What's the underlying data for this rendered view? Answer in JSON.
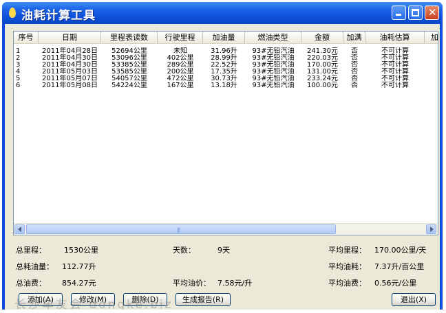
{
  "window": {
    "title": "油耗计算工具"
  },
  "table": {
    "columns": [
      "序号",
      "日期",
      "里程表读数",
      "行驶里程",
      "加油量",
      "燃油类型",
      "金额",
      "加满",
      "油耗估算",
      "加"
    ],
    "rows": [
      [
        "1",
        "2011年04月28日",
        "52694公里",
        "未知",
        "31.96升",
        "93#无铅汽油",
        "241.30元",
        "否",
        "不可计算"
      ],
      [
        "2",
        "2011年04月30日",
        "53096公里",
        "402公里",
        "28.99升",
        "93#无铅汽油",
        "220.03元",
        "否",
        "不可计算"
      ],
      [
        "3",
        "2011年04月30日",
        "53385公里",
        "289公里",
        "22.52升",
        "93#无铅汽油",
        "170.00元",
        "否",
        "不可计算"
      ],
      [
        "4",
        "2011年05月03日",
        "53585公里",
        "200公里",
        "17.35升",
        "93#无铅汽油",
        "131.00元",
        "否",
        "不可计算"
      ],
      [
        "5",
        "2011年05月07日",
        "54057公里",
        "472公里",
        "30.73升",
        "93#无铅汽油",
        "233.24元",
        "否",
        "不可计算"
      ],
      [
        "6",
        "2011年05月08日",
        "54224公里",
        "167公里",
        "13.18升",
        "93#无铅汽油",
        "100.00元",
        "否",
        "不可计算"
      ]
    ]
  },
  "stats": {
    "total_mileage_label": "总里程：",
    "total_mileage": "1530公里",
    "days_label": "天数：",
    "days": "9天",
    "avg_mileage_label": "平均里程：",
    "avg_mileage": "170.00公里/天",
    "total_fuel_label": "总耗油量：",
    "total_fuel": "112.77升",
    "avg_consumption_label": "平均油耗：",
    "avg_consumption": "7.37升/百公里",
    "total_cost_label": "总油费：",
    "total_cost": "854.27元",
    "avg_price_label": "平均油价：",
    "avg_price": "7.58元/升",
    "avg_cost_label": "平均油费：",
    "avg_cost": "0.56元/公里"
  },
  "buttons": {
    "add": "添加(A)",
    "modify": "修改(M)",
    "delete": "删除(D)",
    "report": "生成报告(R)",
    "exit": "退出(X)"
  },
  "watermark": "长沙车友会 dongke.biz",
  "icons": {
    "title": "fuel-drop-icon",
    "minimize": "minimize-icon",
    "maximize": "maximize-icon",
    "close": "close-icon",
    "scroll_left": "scroll-left-arrow-icon",
    "scroll_right": "scroll-right-arrow-icon"
  }
}
